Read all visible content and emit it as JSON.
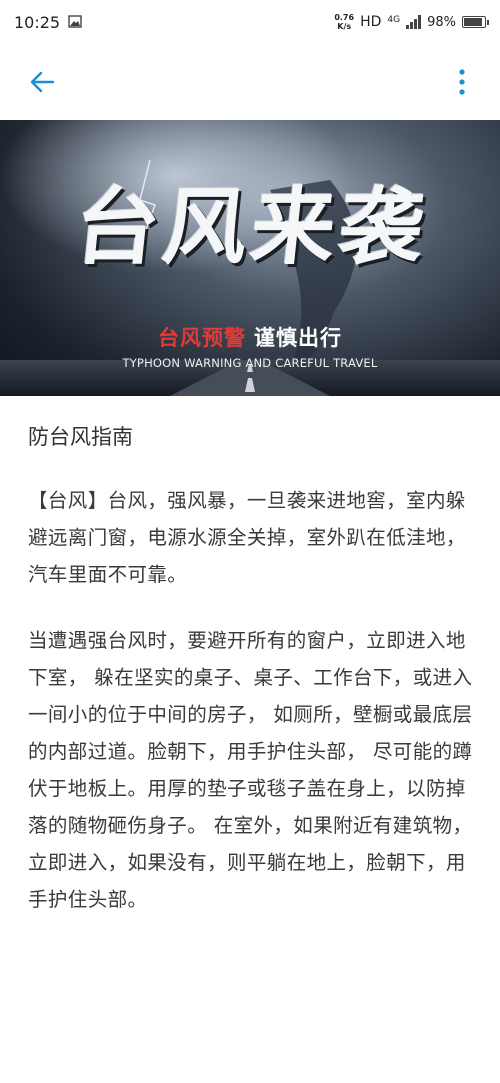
{
  "status_bar": {
    "time": "10:25",
    "speed_value": "0.76",
    "speed_unit": "K/s",
    "hd": "HD",
    "network": "4G",
    "battery": "98%",
    "battery_level": 0.98
  },
  "app_bar": {
    "back_icon": "arrow-left-icon",
    "menu_icon": "more-vertical-icon",
    "accent_color": "#1a8fd6"
  },
  "banner": {
    "title": "台风来袭",
    "subtitle_red": "台风预警",
    "subtitle_white": "谨慎出行",
    "subtitle_en": "TYPHOON WARNING AND CAREFUL TRAVEL"
  },
  "article": {
    "title": "防台风指南",
    "paragraphs": [
      "【台风】台风，强风暴，一旦袭来进地窖，室内躲避远离门窗，电源水源全关掉，室外趴在低洼地，汽车里面不可靠。",
      "当遭遇强台风时，要避开所有的窗户，立即进入地下室， 躲在坚实的桌子、桌子、工作台下，或进入一间小的位于中间的房子， 如厕所，壁橱或最底层的内部过道。脸朝下，用手护住头部， 尽可能的蹲伏于地板上。用厚的垫子或毯子盖在身上，以防掉落的随物砸伤身子。 在室外，如果附近有建筑物，立即进入，如果没有，则平躺在地上，脸朝下，用手护住头部。"
    ]
  }
}
